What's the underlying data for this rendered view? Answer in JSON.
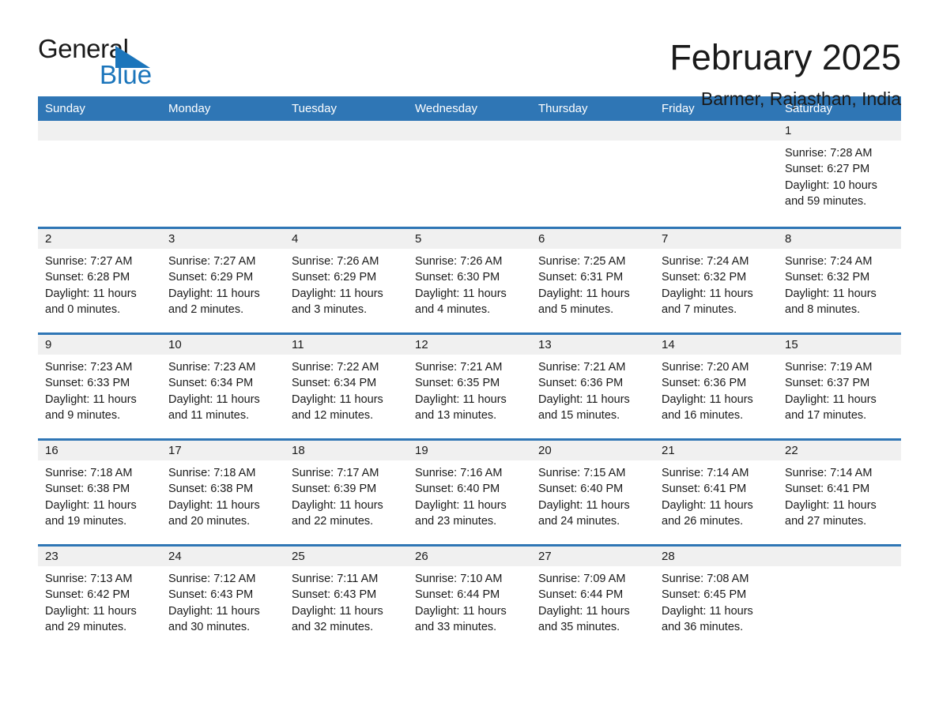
{
  "brand": {
    "name_part1": "General",
    "name_part2": "Blue",
    "accent_color": "#1b75bb",
    "triangle_icon": "blue-triangle-icon"
  },
  "header": {
    "month_title": "February 2025",
    "location": "Barmer, Rajasthan, India"
  },
  "calendar": {
    "header_color": "#2f76b5",
    "day_band_color": "#f0f0f0",
    "weekdays": [
      "Sunday",
      "Monday",
      "Tuesday",
      "Wednesday",
      "Thursday",
      "Friday",
      "Saturday"
    ],
    "weeks": [
      [
        {
          "day": "",
          "sunrise": "",
          "sunset": "",
          "daylight": ""
        },
        {
          "day": "",
          "sunrise": "",
          "sunset": "",
          "daylight": ""
        },
        {
          "day": "",
          "sunrise": "",
          "sunset": "",
          "daylight": ""
        },
        {
          "day": "",
          "sunrise": "",
          "sunset": "",
          "daylight": ""
        },
        {
          "day": "",
          "sunrise": "",
          "sunset": "",
          "daylight": ""
        },
        {
          "day": "",
          "sunrise": "",
          "sunset": "",
          "daylight": ""
        },
        {
          "day": "1",
          "sunrise": "Sunrise: 7:28 AM",
          "sunset": "Sunset: 6:27 PM",
          "daylight": "Daylight: 10 hours and 59 minutes."
        }
      ],
      [
        {
          "day": "2",
          "sunrise": "Sunrise: 7:27 AM",
          "sunset": "Sunset: 6:28 PM",
          "daylight": "Daylight: 11 hours and 0 minutes."
        },
        {
          "day": "3",
          "sunrise": "Sunrise: 7:27 AM",
          "sunset": "Sunset: 6:29 PM",
          "daylight": "Daylight: 11 hours and 2 minutes."
        },
        {
          "day": "4",
          "sunrise": "Sunrise: 7:26 AM",
          "sunset": "Sunset: 6:29 PM",
          "daylight": "Daylight: 11 hours and 3 minutes."
        },
        {
          "day": "5",
          "sunrise": "Sunrise: 7:26 AM",
          "sunset": "Sunset: 6:30 PM",
          "daylight": "Daylight: 11 hours and 4 minutes."
        },
        {
          "day": "6",
          "sunrise": "Sunrise: 7:25 AM",
          "sunset": "Sunset: 6:31 PM",
          "daylight": "Daylight: 11 hours and 5 minutes."
        },
        {
          "day": "7",
          "sunrise": "Sunrise: 7:24 AM",
          "sunset": "Sunset: 6:32 PM",
          "daylight": "Daylight: 11 hours and 7 minutes."
        },
        {
          "day": "8",
          "sunrise": "Sunrise: 7:24 AM",
          "sunset": "Sunset: 6:32 PM",
          "daylight": "Daylight: 11 hours and 8 minutes."
        }
      ],
      [
        {
          "day": "9",
          "sunrise": "Sunrise: 7:23 AM",
          "sunset": "Sunset: 6:33 PM",
          "daylight": "Daylight: 11 hours and 9 minutes."
        },
        {
          "day": "10",
          "sunrise": "Sunrise: 7:23 AM",
          "sunset": "Sunset: 6:34 PM",
          "daylight": "Daylight: 11 hours and 11 minutes."
        },
        {
          "day": "11",
          "sunrise": "Sunrise: 7:22 AM",
          "sunset": "Sunset: 6:34 PM",
          "daylight": "Daylight: 11 hours and 12 minutes."
        },
        {
          "day": "12",
          "sunrise": "Sunrise: 7:21 AM",
          "sunset": "Sunset: 6:35 PM",
          "daylight": "Daylight: 11 hours and 13 minutes."
        },
        {
          "day": "13",
          "sunrise": "Sunrise: 7:21 AM",
          "sunset": "Sunset: 6:36 PM",
          "daylight": "Daylight: 11 hours and 15 minutes."
        },
        {
          "day": "14",
          "sunrise": "Sunrise: 7:20 AM",
          "sunset": "Sunset: 6:36 PM",
          "daylight": "Daylight: 11 hours and 16 minutes."
        },
        {
          "day": "15",
          "sunrise": "Sunrise: 7:19 AM",
          "sunset": "Sunset: 6:37 PM",
          "daylight": "Daylight: 11 hours and 17 minutes."
        }
      ],
      [
        {
          "day": "16",
          "sunrise": "Sunrise: 7:18 AM",
          "sunset": "Sunset: 6:38 PM",
          "daylight": "Daylight: 11 hours and 19 minutes."
        },
        {
          "day": "17",
          "sunrise": "Sunrise: 7:18 AM",
          "sunset": "Sunset: 6:38 PM",
          "daylight": "Daylight: 11 hours and 20 minutes."
        },
        {
          "day": "18",
          "sunrise": "Sunrise: 7:17 AM",
          "sunset": "Sunset: 6:39 PM",
          "daylight": "Daylight: 11 hours and 22 minutes."
        },
        {
          "day": "19",
          "sunrise": "Sunrise: 7:16 AM",
          "sunset": "Sunset: 6:40 PM",
          "daylight": "Daylight: 11 hours and 23 minutes."
        },
        {
          "day": "20",
          "sunrise": "Sunrise: 7:15 AM",
          "sunset": "Sunset: 6:40 PM",
          "daylight": "Daylight: 11 hours and 24 minutes."
        },
        {
          "day": "21",
          "sunrise": "Sunrise: 7:14 AM",
          "sunset": "Sunset: 6:41 PM",
          "daylight": "Daylight: 11 hours and 26 minutes."
        },
        {
          "day": "22",
          "sunrise": "Sunrise: 7:14 AM",
          "sunset": "Sunset: 6:41 PM",
          "daylight": "Daylight: 11 hours and 27 minutes."
        }
      ],
      [
        {
          "day": "23",
          "sunrise": "Sunrise: 7:13 AM",
          "sunset": "Sunset: 6:42 PM",
          "daylight": "Daylight: 11 hours and 29 minutes."
        },
        {
          "day": "24",
          "sunrise": "Sunrise: 7:12 AM",
          "sunset": "Sunset: 6:43 PM",
          "daylight": "Daylight: 11 hours and 30 minutes."
        },
        {
          "day": "25",
          "sunrise": "Sunrise: 7:11 AM",
          "sunset": "Sunset: 6:43 PM",
          "daylight": "Daylight: 11 hours and 32 minutes."
        },
        {
          "day": "26",
          "sunrise": "Sunrise: 7:10 AM",
          "sunset": "Sunset: 6:44 PM",
          "daylight": "Daylight: 11 hours and 33 minutes."
        },
        {
          "day": "27",
          "sunrise": "Sunrise: 7:09 AM",
          "sunset": "Sunset: 6:44 PM",
          "daylight": "Daylight: 11 hours and 35 minutes."
        },
        {
          "day": "28",
          "sunrise": "Sunrise: 7:08 AM",
          "sunset": "Sunset: 6:45 PM",
          "daylight": "Daylight: 11 hours and 36 minutes."
        },
        {
          "day": "",
          "sunrise": "",
          "sunset": "",
          "daylight": ""
        }
      ]
    ]
  }
}
